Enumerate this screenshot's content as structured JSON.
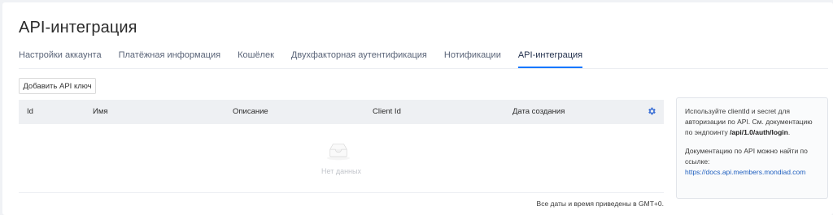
{
  "page": {
    "title": "API-интеграция"
  },
  "tabs": [
    {
      "label": "Настройки аккаунта",
      "active": false
    },
    {
      "label": "Платёжная информация",
      "active": false
    },
    {
      "label": "Кошёлек",
      "active": false
    },
    {
      "label": "Двухфакторная аутентификация",
      "active": false
    },
    {
      "label": "Нотификации",
      "active": false
    },
    {
      "label": "API-интеграция",
      "active": true
    }
  ],
  "toolbar": {
    "add_label": "Добавить API ключ"
  },
  "table": {
    "columns": [
      "Id",
      "Имя",
      "Описание",
      "Client Id",
      "Дата создания"
    ],
    "rows": [],
    "empty_text": "Нет данных",
    "settings_icon": "gear-icon",
    "empty_icon": "inbox-icon"
  },
  "footnote": "Все даты и время приведены в GMT+0.",
  "info": {
    "p1_before": "Используйте clientId и secret для авторизации по API. См. документацию по эндпоинту ",
    "p1_bold": "/api/1.0/auth/login",
    "p1_after": ".",
    "p2_text": "Документацию по API можно найти по ссылке:",
    "p2_link": "https://docs.api.members.mondiad.com"
  },
  "colors": {
    "accent": "#1677ff",
    "link": "#1f5fbf",
    "header_bg": "#eef0f3"
  }
}
